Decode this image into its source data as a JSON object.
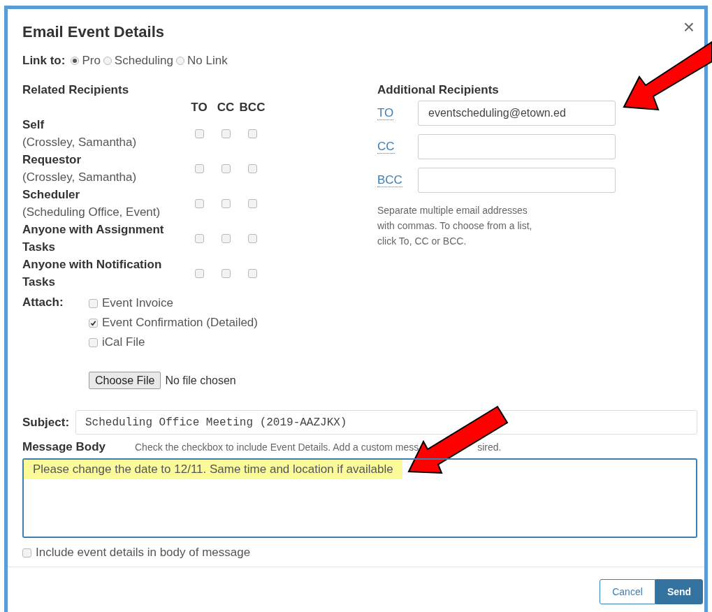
{
  "dialog": {
    "title": "Email Event Details",
    "close": "×"
  },
  "link_to": {
    "label": "Link to:",
    "options": [
      {
        "label": "Pro",
        "selected": true
      },
      {
        "label": "Scheduling",
        "selected": false
      },
      {
        "label": "No Link",
        "selected": false
      }
    ]
  },
  "related_recipients": {
    "title": "Related Recipients",
    "columns": [
      "TO",
      "CC",
      "BCC"
    ],
    "rows": [
      {
        "name": "Self",
        "detail": "(Crossley, Samantha)",
        "checks": [
          {
            "checked": false
          },
          {
            "checked": false
          },
          {
            "checked": false
          }
        ]
      },
      {
        "name": "Requestor",
        "detail": "(Crossley, Samantha)",
        "checks": [
          {
            "checked": false
          },
          {
            "checked": false
          },
          {
            "checked": false
          }
        ]
      },
      {
        "name": "Scheduler",
        "detail": "(Scheduling Office, Event)",
        "checks": [
          {
            "checked": false
          },
          {
            "checked": false
          },
          {
            "checked": false
          }
        ]
      },
      {
        "name": "Anyone with Assignment Tasks",
        "checks": [
          {
            "checked": false
          },
          {
            "checked": false
          },
          {
            "checked": false
          }
        ]
      },
      {
        "name": "Anyone with Notification Tasks",
        "checks": [
          {
            "checked": false
          },
          {
            "checked": false
          },
          {
            "checked": false
          }
        ]
      }
    ]
  },
  "additional_recipients": {
    "title": "Additional Recipients",
    "fields": [
      {
        "label": "TO",
        "value": "eventscheduling@etown.ed"
      },
      {
        "label": "CC"
      },
      {
        "label": "BCC"
      }
    ],
    "help": "Separate multiple email addresses with commas. To choose from a list, click To, CC or BCC."
  },
  "attach": {
    "label": "Attach:",
    "options": [
      {
        "label": "Event Invoice",
        "checked": false
      },
      {
        "label": "Event Confirmation (Detailed)",
        "checked": true
      },
      {
        "label": "iCal File",
        "checked": false
      }
    ],
    "file_button": "Choose File",
    "file_status": "No file chosen"
  },
  "subject": {
    "label": "Subject:",
    "value": "Scheduling Office Meeting (2019-AAZJKX)"
  },
  "message_body": {
    "label": "Message Body",
    "hint_parts": [
      "Check the checkbox to include Event Details. Add a custom mess",
      "sired."
    ],
    "value": "Please change the date to 12/11. Same time and location if available",
    "highlighted": true
  },
  "include_details": {
    "label": "Include event details in body of message",
    "checked": false
  },
  "buttons": [
    {
      "label": "Cancel",
      "kind": "secondary"
    },
    {
      "label": "Send",
      "kind": "primary"
    }
  ]
}
